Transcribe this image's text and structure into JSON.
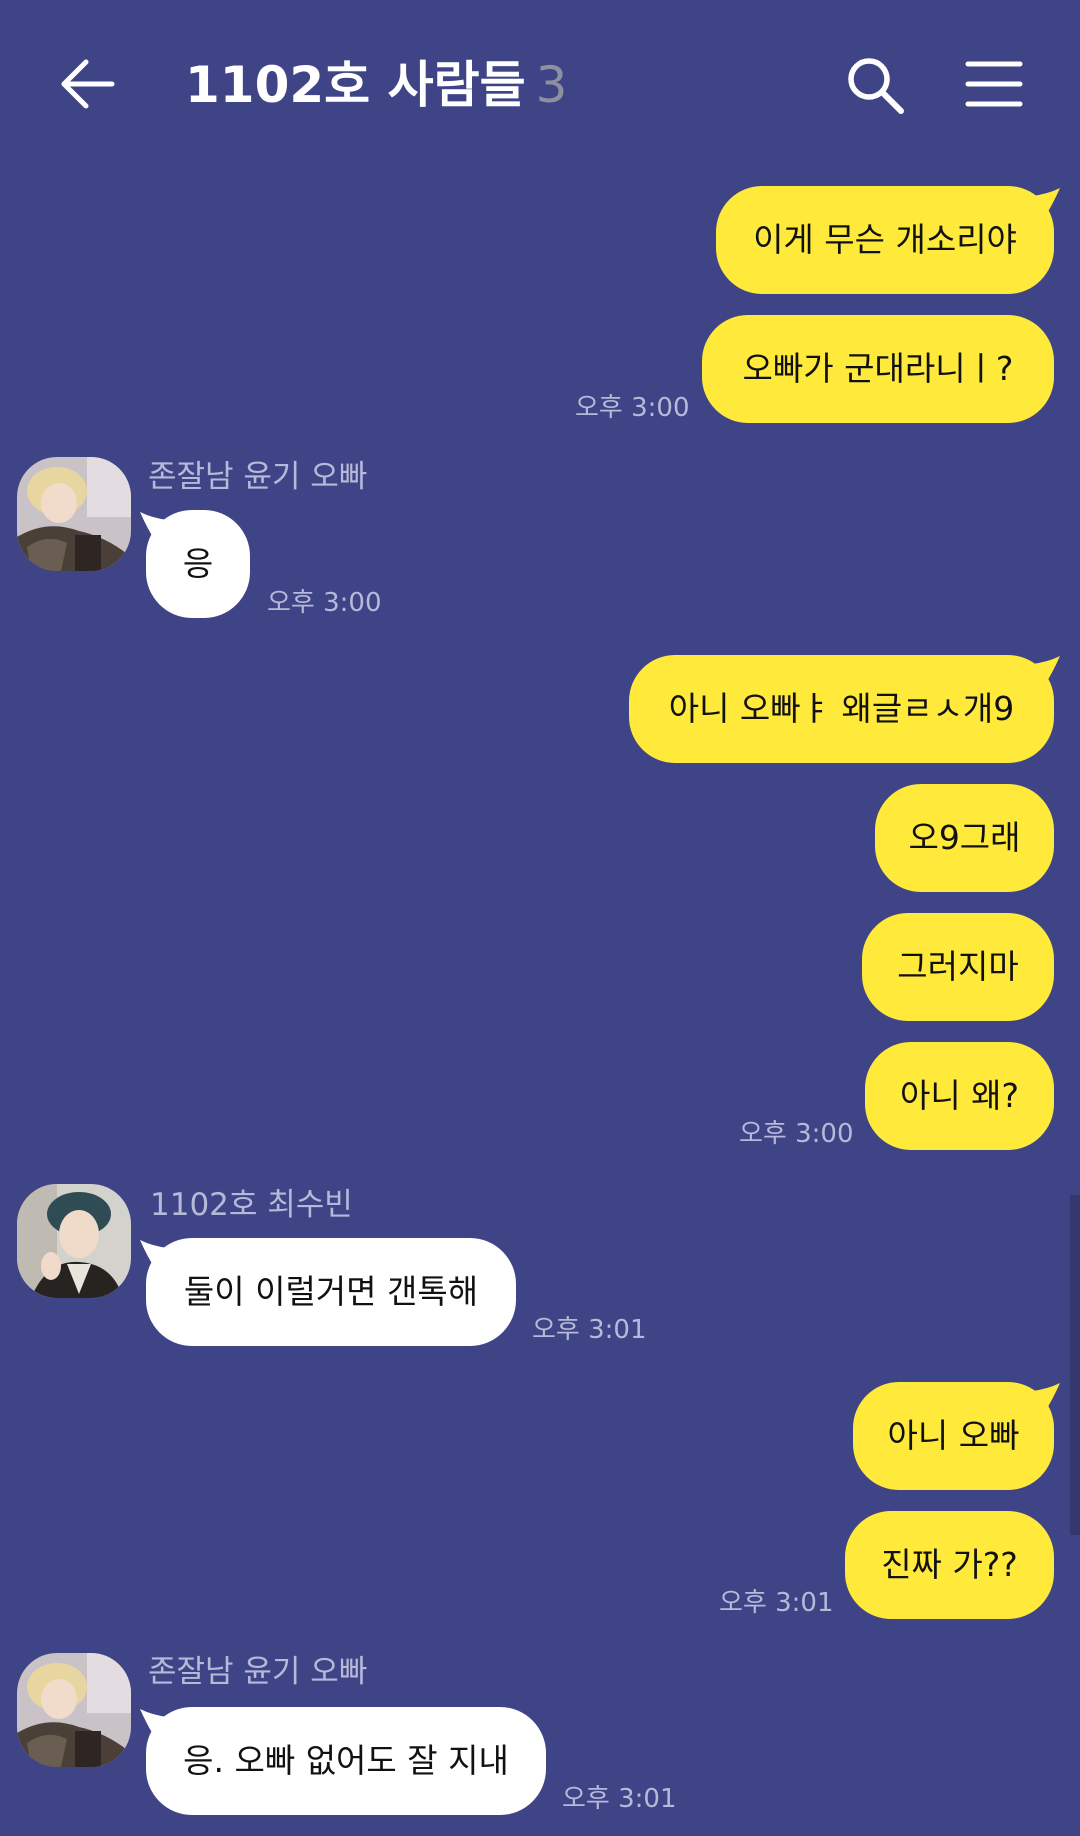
{
  "header": {
    "title": "1102호 사람들",
    "member_count": "3",
    "back_icon": "arrow-left-icon",
    "search_icon": "search-icon",
    "menu_icon": "hamburger-menu-icon"
  },
  "colors": {
    "background": "#3f4487",
    "my_bubble": "#ffe93b",
    "their_bubble": "#ffffff",
    "meta_text": "#b6b9d8"
  },
  "messages": {
    "m1": "이게 무슨 개소리야",
    "m2": "오빠가 군대라니ㅣ?",
    "t1": "오후 3:00",
    "yoongi_name_1": "존잘남 윤기 오빠",
    "m3": "응",
    "t2": "오후 3:00",
    "m4": "아니 오빠ㅑ 왜글ㄹㅅ개9",
    "m5": "오9그래",
    "m6": "그러지마",
    "m7": "아니 왜?",
    "t3": "오후 3:00",
    "soobin_name": "1102호 최수빈",
    "m8": "둘이 이럴거면 갠톡해",
    "t4": "오후 3:01",
    "m9": "아니 오빠",
    "m10": "진짜 가??",
    "t5": "오후 3:01",
    "yoongi_name_2": "존잘남 윤기 오빠",
    "m11": "응. 오빠 없어도 잘 지내",
    "t6": "오후 3:01"
  }
}
